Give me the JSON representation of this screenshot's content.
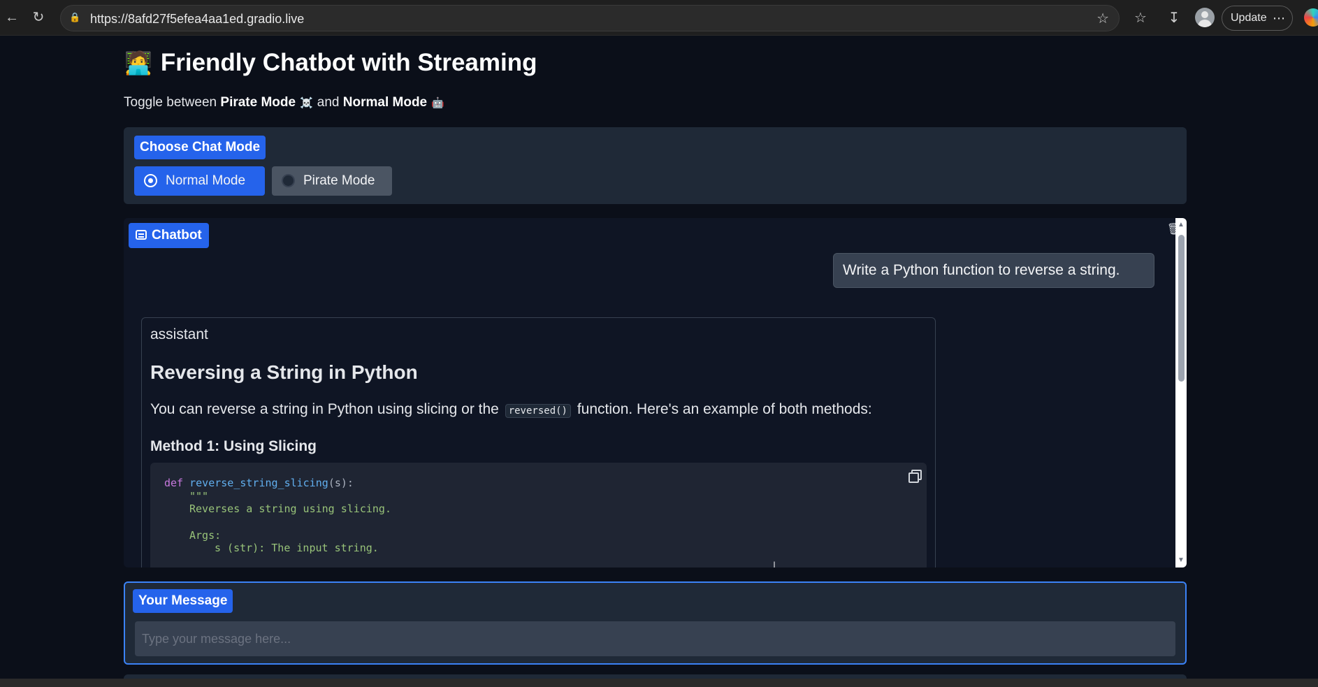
{
  "browser": {
    "url": "https://8afd27f5efea4aa1ed.gradio.live",
    "update_label": "Update",
    "more_label": "⋯"
  },
  "header": {
    "title_emoji": "🧑‍💻",
    "title": "Friendly Chatbot with Streaming",
    "subtitle_prefix": "Toggle between",
    "pirate_mode": "Pirate Mode",
    "pirate_emoji": "☠️",
    "and": "and",
    "normal_mode": "Normal Mode",
    "normal_emoji": "🤖"
  },
  "mode_selector": {
    "label": "Choose Chat Mode",
    "options": [
      {
        "label": "Normal Mode",
        "selected": true
      },
      {
        "label": "Pirate Mode",
        "selected": false
      }
    ]
  },
  "chatbot": {
    "label": "Chatbot",
    "user_message": "Write a Python function to reverse a string.",
    "assistant": {
      "role": "assistant",
      "heading": "Reversing a String in Python",
      "intro_before": "You can reverse a string in Python using slicing or the",
      "intro_code": "reversed()",
      "intro_after": "function. Here's an example of both methods:",
      "method_heading": "Method 1: Using Slicing",
      "code": {
        "line1_kw": "def",
        "line1_fn": "reverse_string_slicing",
        "line1_rest": "(s):",
        "line2": "\"\"\"",
        "line3": "Reverses a string using slicing.",
        "line4": "Args:",
        "line5": "s (str): The input string."
      }
    }
  },
  "message_box": {
    "label": "Your Message",
    "placeholder": "Type your message here..."
  }
}
